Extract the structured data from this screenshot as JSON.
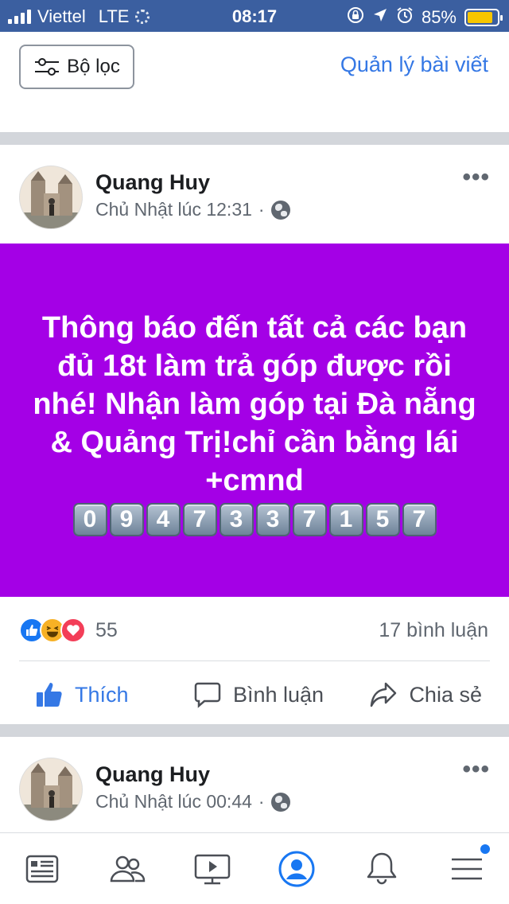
{
  "status_bar": {
    "carrier": "Viettel",
    "network": "LTE",
    "time": "08:17",
    "battery_percent": "85%",
    "battery_level": 0.85,
    "icons": [
      "signal-icon",
      "loading-icon",
      "orientation-lock-icon",
      "location-icon",
      "alarm-icon",
      "battery-icon"
    ]
  },
  "toolbar": {
    "filter_label": "Bộ lọc",
    "manage_label": "Quản lý bài viết"
  },
  "action_labels": {
    "like": "Thích",
    "comment": "Bình luận",
    "share": "Chia sẻ"
  },
  "posts": [
    {
      "author": "Quang Huy",
      "timestamp": "Chủ Nhật lúc 12:31",
      "separator": "·",
      "text": "Thông báo đến tất cả các bạn đủ 18t làm trả góp được rồi nhé! Nhận làm góp tại Đà nẵng & Quảng Trị!chỉ cần bằng lái +cmnd",
      "digits": [
        "0",
        "9",
        "4",
        "7",
        "3",
        "3",
        "7",
        "1",
        "5",
        "7"
      ],
      "background_color": "#a400e6",
      "reaction_count": "55",
      "comment_count": "17 bình luận"
    },
    {
      "author": "Quang Huy",
      "timestamp": "Chủ Nhật lúc 00:44",
      "separator": "·"
    }
  ],
  "tabs": [
    "news-feed-icon",
    "friends-icon",
    "watch-icon",
    "profile-icon",
    "notifications-icon",
    "menu-icon"
  ],
  "colors": {
    "accent": "#3578e5",
    "status_bar": "#3b5fa0",
    "battery": "#f7c600"
  }
}
